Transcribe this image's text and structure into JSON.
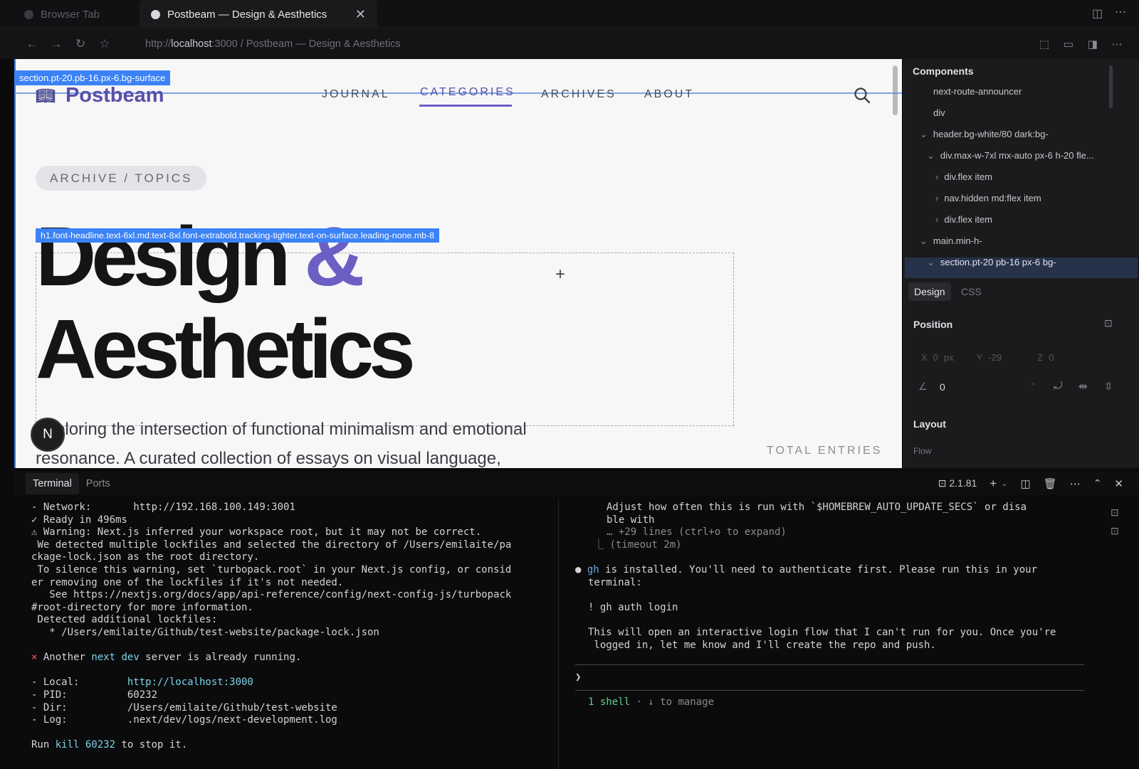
{
  "browser": {
    "tabs": [
      {
        "label": "Browser Tab",
        "active": false
      },
      {
        "label": "Postbeam — Design & Aesthetics",
        "active": true
      }
    ],
    "url_prefix": "http://",
    "url_host": "localhost",
    "url_rest": ":3000 / Postbeam — Design & Aesthetics"
  },
  "page": {
    "section_badge": "section.pt-20.pb-16.px-6.bg-surface",
    "logo": "Postbeam",
    "nav": [
      "JOURNAL",
      "CATEGORIES",
      "ARCHIVES",
      "ABOUT"
    ],
    "pill": "ARCHIVE / TOPICS",
    "h1_badge": "h1.font-headline.text-6xl.md:text-8xl.font-extrabold.tracking-tighter.text-on-surface.leading-none.mb-8",
    "title_word1": "Design",
    "title_amp": "&",
    "title_word2": "Aesthetics",
    "lead_line1": "Exploring the intersection of functional minimalism and emotional",
    "lead_line2": "resonance. A curated collection of essays on visual language,",
    "total_entries": "TOTAL ENTRIES",
    "avatar_letter": "N"
  },
  "inspector": {
    "components_title": "Components",
    "tree": [
      "next-route-announcer",
      "div",
      "header.bg-white/80 dark:bg-",
      "div.max-w-7xl mx-auto px-6 h-20 fle...",
      "div.flex item",
      "nav.hidden md:flex item",
      "div.flex item",
      "main.min-h-",
      "section.pt-20 pb-16 px-6 bg-"
    ],
    "tabs": [
      "Design",
      "CSS"
    ],
    "position_title": "Position",
    "x_label": "X",
    "x_value": "0",
    "x_unit": "px",
    "y_label": "Y",
    "y_value": "-29",
    "z_label": "Z",
    "z_value": "0",
    "rotation": "0",
    "rotation_unit": "°",
    "layout_title": "Layout",
    "flow_label": "Flow"
  },
  "terminal": {
    "tabs": [
      "Terminal",
      "Ports"
    ],
    "version": "2.1.81",
    "left": {
      "network_label": "- Network:",
      "network_url": "http://192.168.100.149:3001",
      "ready": "✓ Ready in 496ms",
      "warn1": "⚠ Warning: Next.js inferred your workspace root, but it may not be correct.",
      "warn2": " We detected multiple lockfiles and selected the directory of /Users/emilaite/pa",
      "warn3": "ckage-lock.json as the root directory.",
      "warn4": " To silence this warning, set `turbopack.root` in your Next.js config, or consid",
      "warn5": "er removing one of the lockfiles if it's not needed.",
      "warn6": "   See https://nextjs.org/docs/app/api-reference/config/next-config-js/turbopack",
      "warn7": "#root-directory for more information.",
      "warn8": " Detected additional lockfiles:",
      "warn9": "   * /Users/emilaite/Github/test-website/package-lock.json",
      "err_pre": "Another ",
      "err_code": "next dev",
      "err_post": " server is already running.",
      "local_label": "- Local:        ",
      "local_url": "http://localhost:3000",
      "pid": "- PID:          60232",
      "dir": "- Dir:          /Users/emilaite/Github/test-website",
      "log": "- Log:          .next/dev/logs/next-development.log",
      "run_pre": "Run ",
      "run_cmd": "kill 60232",
      "run_post": " to stop it."
    },
    "right": {
      "l1": "Adjust how often this is run with `$HOMEBREW_AUTO_UPDATE_SECS` or disa",
      "l2": "ble with",
      "l3": "… +29 lines (ctrl+o to expand)",
      "l4": "(timeout 2m)",
      "gh": "gh",
      "l5": " is installed. You'll need to authenticate first. Please run this in your",
      "l6": "terminal:",
      "l7": "! gh auth login",
      "l8": "This will open an interactive login flow that I can't run for you. Once you're",
      "l9": " logged in, let me know and I'll create the repo and push.",
      "prompt": "❯",
      "shell_count": "1 shell",
      "shell_hint": " · ↓ to manage"
    }
  }
}
